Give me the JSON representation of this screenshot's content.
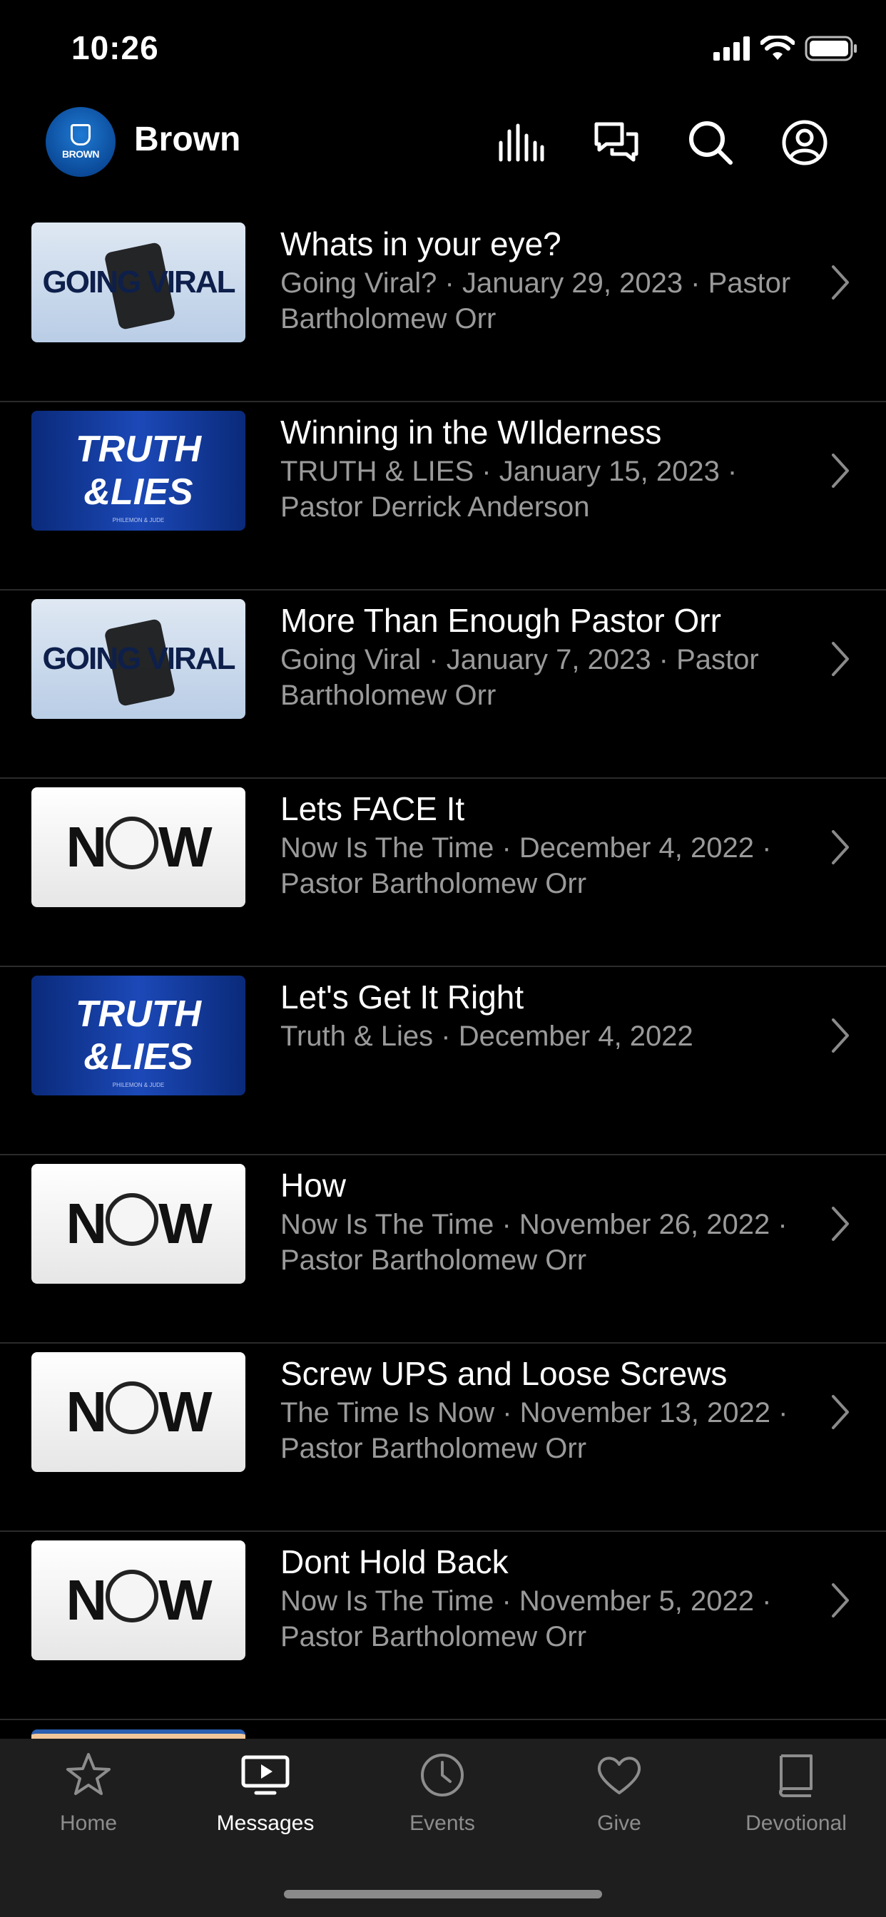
{
  "status_bar": {
    "time": "10:26"
  },
  "header": {
    "brand": "Brown",
    "logo_text": "BROWN"
  },
  "messages": [
    {
      "title": "Whats in your eye?",
      "subtitle": "Going Viral? · January 29, 2023 · Pastor Bartholomew Orr",
      "thumb": "viral",
      "thumb_text": "GOING VIRAL"
    },
    {
      "title": "Winning in the WIlderness",
      "subtitle": "TRUTH & LIES · January 15, 2023 · Pastor Derrick Anderson",
      "thumb": "truth",
      "thumb_text": "TRUTH &LIES",
      "thumb_caption": "PHILEMON & JUDE"
    },
    {
      "title": "More Than Enough Pastor Orr",
      "subtitle": "Going Viral · January 7, 2023 · Pastor Bartholomew Orr",
      "thumb": "viral",
      "thumb_text": "GOING VIRAL"
    },
    {
      "title": "Lets FACE It",
      "subtitle": "Now Is The Time · December 4, 2022 · Pastor Bartholomew Orr",
      "thumb": "now",
      "thumb_text": "NOW"
    },
    {
      "title": "Let's Get It Right",
      "subtitle": "Truth & Lies · December 4, 2022",
      "thumb": "truth",
      "thumb_text": "TRUTH &LIES",
      "thumb_caption": "PHILEMON & JUDE"
    },
    {
      "title": "How",
      "subtitle": "Now Is The Time · November 26, 2022 · Pastor Bartholomew Orr",
      "thumb": "now",
      "thumb_text": "NOW"
    },
    {
      "title": "Screw UPS and Loose Screws",
      "subtitle": "The Time Is Now · November 13, 2022 · Pastor Bartholomew Orr",
      "thumb": "now",
      "thumb_text": "NOW"
    },
    {
      "title": "Dont Hold Back",
      "subtitle": "Now Is The Time · November 5, 2022 · Pastor Bartholomew Orr",
      "thumb": "now",
      "thumb_text": "NOW"
    }
  ],
  "tabs": [
    {
      "label": "Home",
      "icon": "star-icon",
      "active": false
    },
    {
      "label": "Messages",
      "icon": "tv-play-icon",
      "active": true
    },
    {
      "label": "Events",
      "icon": "clock-icon",
      "active": false
    },
    {
      "label": "Give",
      "icon": "heart-icon",
      "active": false
    },
    {
      "label": "Devotional",
      "icon": "book-icon",
      "active": false
    }
  ],
  "colors": {
    "background": "#000000",
    "tabbar": "#1e1e1e",
    "subtitle": "#9a9a9a",
    "divider": "#2b2b2b"
  }
}
